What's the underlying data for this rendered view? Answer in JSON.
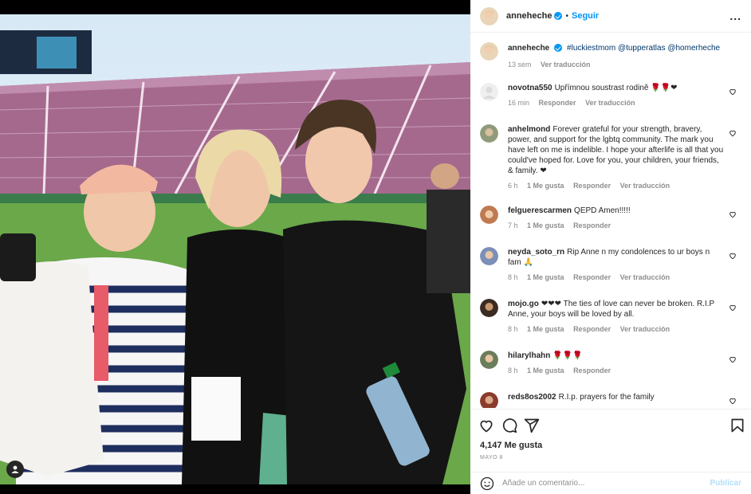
{
  "post": {
    "username": "anneheche",
    "follow_label": "Seguir",
    "separator": "•",
    "more_label": "..."
  },
  "caption": {
    "username": "anneheche",
    "text": "#luckiestmom @tupperatlas @homerheche",
    "time": "13 sem",
    "translate": "Ver traducción"
  },
  "comments": [
    {
      "username": "novotna550",
      "text": "Upřímnou soustrast rodině 🌹🌹❤",
      "time": "16 min",
      "likes": "",
      "reply": "Responder",
      "translate": "Ver traducción"
    },
    {
      "username": "anhelmond",
      "text": "Forever grateful for your strength, bravery, power, and support for the lgbtq community. The mark you have left on me is indelible. I hope your afterlife is all that you could've hoped for. Love for you, your children, your friends, & family. ❤",
      "time": "6 h",
      "likes": "1 Me gusta",
      "reply": "Responder",
      "translate": "Ver traducción"
    },
    {
      "username": "felgueres​carmen",
      "text": "QEPD Amen!!!!!",
      "time": "7 h",
      "likes": "1 Me gusta",
      "reply": "Responder",
      "translate": ""
    },
    {
      "username": "neyda_soto_rn",
      "text": "Rip Anne n my condolences to ur boys n fam 🙏",
      "time": "8 h",
      "likes": "1 Me gusta",
      "reply": "Responder",
      "translate": "Ver traducción"
    },
    {
      "username": "mojo.go",
      "text": "❤❤❤ The ties of love can never be broken. R.I.P Anne, your boys will be loved by all.",
      "time": "8 h",
      "likes": "1 Me gusta",
      "reply": "Responder",
      "translate": "Ver traducción"
    },
    {
      "username": "hilarylhahn",
      "text": "🌹🌹🌹",
      "time": "8 h",
      "likes": "1 Me gusta",
      "reply": "Responder",
      "translate": ""
    },
    {
      "username": "reds8os2002",
      "text": "R.I.p. prayers for the family",
      "time": "",
      "likes": "",
      "reply": "",
      "translate": ""
    }
  ],
  "footer": {
    "likes": "4,147 Me gusta",
    "date": "MAYO 8",
    "add_comment_placeholder": "Añade un comentario...",
    "publish_label": "Publicar"
  },
  "icons": {
    "like": "heart-icon",
    "comment": "comment-icon",
    "share": "share-icon",
    "save": "bookmark-icon",
    "emoji": "emoji-icon",
    "more": "more-icon",
    "tag": "user-tag-icon"
  },
  "colors": {
    "accent": "#0095f6",
    "heart": "#ed4956",
    "text": "#262626",
    "muted": "#8e8e8e"
  }
}
